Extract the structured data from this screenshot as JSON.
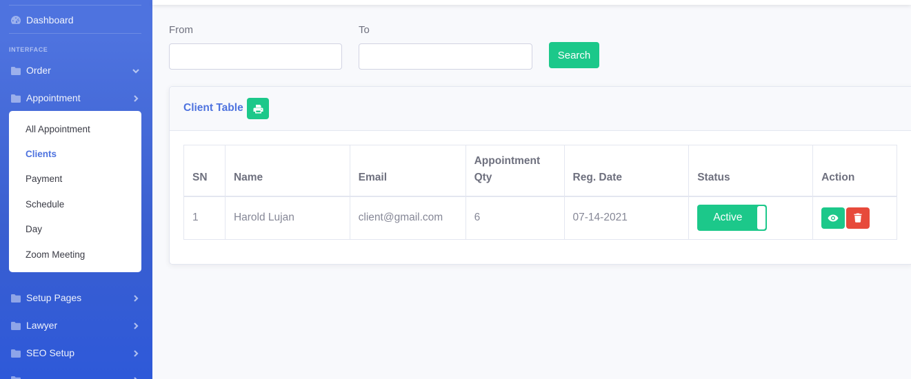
{
  "sidebar": {
    "dashboard": {
      "label": "Dashboard",
      "icon": "dashboard-icon"
    },
    "heading": "INTERFACE",
    "items": [
      {
        "label": "Order",
        "icon": "folder-icon",
        "chevron": "chevron-down-icon"
      },
      {
        "label": "Appointment",
        "icon": "folder-icon",
        "chevron": "chevron-right-icon"
      }
    ],
    "appointment_submenu": [
      {
        "label": "All Appointment"
      },
      {
        "label": "Clients",
        "active": true
      },
      {
        "label": "Payment"
      },
      {
        "label": "Schedule"
      },
      {
        "label": "Day"
      },
      {
        "label": "Zoom Meeting"
      }
    ],
    "items_after": [
      {
        "label": "Setup Pages",
        "icon": "folder-icon",
        "chevron": "chevron-right-icon"
      },
      {
        "label": "Lawyer",
        "icon": "folder-icon",
        "chevron": "chevron-right-icon"
      },
      {
        "label": "SEO Setup",
        "icon": "folder-icon",
        "chevron": "chevron-right-icon"
      },
      {
        "label": "",
        "icon": "folder-icon",
        "chevron": "chevron-right-icon"
      }
    ]
  },
  "filter": {
    "from_label": "From",
    "from_value": "",
    "to_label": "To",
    "to_value": "",
    "search_label": "Search"
  },
  "card": {
    "title": "Client Table",
    "print_icon": "printer-icon"
  },
  "table": {
    "headers": [
      "SN",
      "Name",
      "Email",
      "Appointment Qty",
      "Reg. Date",
      "Status",
      "Action"
    ],
    "rows": [
      {
        "sn": "1",
        "name": "Harold Lujan",
        "email": "client@gmail.com",
        "qty": "6",
        "reg_date": "07-14-2021",
        "status": "Active"
      }
    ],
    "action_icons": [
      "eye-icon",
      "trash-icon"
    ]
  },
  "colors": {
    "sidebar": "#4e73df",
    "accent": "#4e73df",
    "success": "#1cc88a",
    "danger": "#e74a3b"
  }
}
